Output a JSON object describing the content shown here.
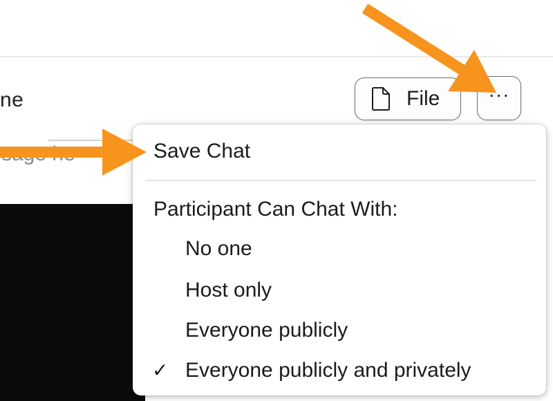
{
  "header": {
    "partial_label": "ne"
  },
  "compose": {
    "partial_placeholder": "sage he"
  },
  "toolbar": {
    "file_button_label": "File",
    "more_button_label": "···"
  },
  "menu": {
    "save_chat": "Save Chat",
    "section_heading": "Participant Can Chat With:",
    "options": [
      {
        "label": "No one",
        "checked": false
      },
      {
        "label": "Host only",
        "checked": false
      },
      {
        "label": "Everyone publicly",
        "checked": false
      },
      {
        "label": "Everyone publicly and privately",
        "checked": true
      }
    ],
    "check_glyph": "✓"
  },
  "annotations": {
    "arrow_color": "#F7941D"
  },
  "icons": {
    "file": "file-icon",
    "more": "more-options-icon",
    "check": "checkmark-icon"
  }
}
